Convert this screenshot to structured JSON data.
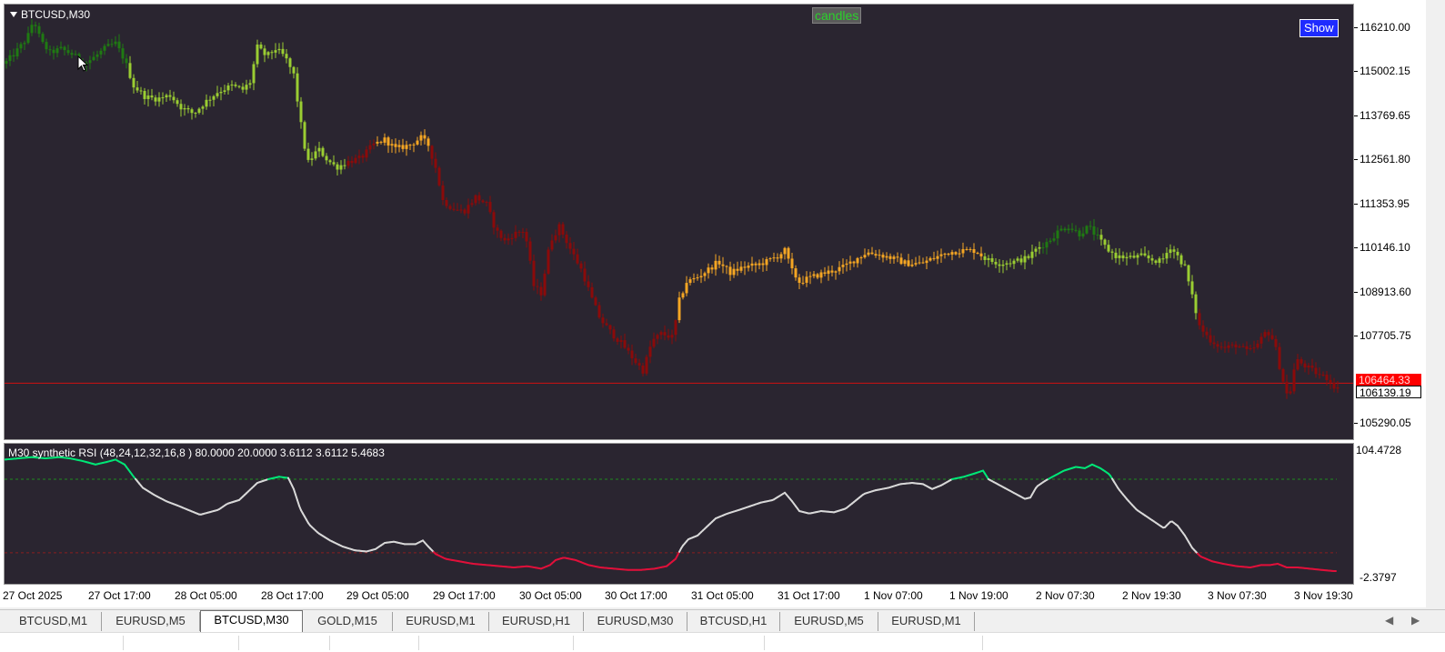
{
  "window": {
    "symbol_label": "BTCUSD,M30",
    "candles_button": "candles",
    "show_button": "Show"
  },
  "price_axis": {
    "ticks": [
      "116210.00",
      "115002.15",
      "113769.65",
      "112561.80",
      "111353.95",
      "110146.10",
      "108913.60",
      "107705.75",
      "105290.05"
    ],
    "bid_tag": "106464.33",
    "crosshair_tag": "106139.19"
  },
  "rsi": {
    "title": "M30 synthetic RSI  (48,24,12,32,16,8 ) 80.0000 20.0000 3.6112 3.6112 5.4683",
    "axis_top": "104.4728",
    "axis_bottom": "-2.3797",
    "upper_level": 80,
    "lower_level": 20
  },
  "time_axis": {
    "labels": [
      "27 Oct 2025",
      "27 Oct 17:00",
      "28 Oct 05:00",
      "28 Oct 17:00",
      "29 Oct 05:00",
      "29 Oct 17:00",
      "30 Oct 05:00",
      "30 Oct 17:00",
      "31 Oct 05:00",
      "31 Oct 17:00",
      "1 Nov 07:00",
      "1 Nov 19:00",
      "2 Nov 07:30",
      "2 Nov 19:30",
      "3 Nov 07:30",
      "3 Nov 19:30"
    ]
  },
  "tabs": [
    {
      "label": "BTCUSD,M1",
      "active": false
    },
    {
      "label": "EURUSD,M5",
      "active": false
    },
    {
      "label": "BTCUSD,M30",
      "active": true
    },
    {
      "label": "GOLD,M15",
      "active": false
    },
    {
      "label": "EURUSD,M1",
      "active": false
    },
    {
      "label": "EURUSD,H1",
      "active": false
    },
    {
      "label": "EURUSD,M30",
      "active": false
    },
    {
      "label": "BTCUSD,H1",
      "active": false
    },
    {
      "label": "EURUSD,M5",
      "active": false
    },
    {
      "label": "EURUSD,M1",
      "active": false
    }
  ],
  "colors": {
    "background": "#2a2530",
    "strong_up": "#1f7a12",
    "up": "#9acd32",
    "neutral": "#f5a623",
    "down": "#8b0a0a",
    "rsi_high": "#00e676",
    "rsi_mid": "#d8d8d8",
    "rsi_low": "#e0103a",
    "bid_line": "#d01010"
  },
  "chart_data": {
    "type": "candlestick",
    "ylim": [
      104900,
      116700
    ],
    "bid": 106464.33,
    "price_path": [
      [
        0,
        115100
      ],
      [
        12,
        115400
      ],
      [
        25,
        115800
      ],
      [
        32,
        116300
      ],
      [
        40,
        115700
      ],
      [
        50,
        115400
      ],
      [
        62,
        115500
      ],
      [
        75,
        115350
      ],
      [
        88,
        115100
      ],
      [
        100,
        115300
      ],
      [
        112,
        115550
      ],
      [
        122,
        115650
      ],
      [
        132,
        115200
      ],
      [
        142,
        114500
      ],
      [
        155,
        114200
      ],
      [
        168,
        114150
      ],
      [
        182,
        114250
      ],
      [
        195,
        113900
      ],
      [
        208,
        113750
      ],
      [
        220,
        114050
      ],
      [
        235,
        114350
      ],
      [
        250,
        114500
      ],
      [
        262,
        114400
      ],
      [
        270,
        114600
      ],
      [
        278,
        115550
      ],
      [
        288,
        115300
      ],
      [
        298,
        115500
      ],
      [
        308,
        115300
      ],
      [
        318,
        114800
      ],
      [
        325,
        113600
      ],
      [
        333,
        112400
      ],
      [
        345,
        112800
      ],
      [
        355,
        112500
      ],
      [
        365,
        112300
      ],
      [
        378,
        112450
      ],
      [
        392,
        112550
      ],
      [
        405,
        112900
      ],
      [
        418,
        113050
      ],
      [
        430,
        112800
      ],
      [
        445,
        112900
      ],
      [
        458,
        113100
      ],
      [
        466,
        112900
      ],
      [
        474,
        112300
      ],
      [
        482,
        111400
      ],
      [
        492,
        111200
      ],
      [
        505,
        111100
      ],
      [
        518,
        111500
      ],
      [
        530,
        111300
      ],
      [
        540,
        110600
      ],
      [
        550,
        110300
      ],
      [
        560,
        110500
      ],
      [
        572,
        110600
      ],
      [
        582,
        109100
      ],
      [
        590,
        108900
      ],
      [
        600,
        110300
      ],
      [
        610,
        110700
      ],
      [
        622,
        110100
      ],
      [
        635,
        109500
      ],
      [
        645,
        108800
      ],
      [
        655,
        108200
      ],
      [
        668,
        107800
      ],
      [
        680,
        107500
      ],
      [
        692,
        107100
      ],
      [
        702,
        106800
      ],
      [
        712,
        107600
      ],
      [
        722,
        107800
      ],
      [
        735,
        107700
      ],
      [
        742,
        108700
      ],
      [
        750,
        109200
      ],
      [
        760,
        109300
      ],
      [
        772,
        109500
      ],
      [
        785,
        109750
      ],
      [
        798,
        109450
      ],
      [
        812,
        109600
      ],
      [
        826,
        109650
      ],
      [
        838,
        109750
      ],
      [
        850,
        109900
      ],
      [
        858,
        110050
      ],
      [
        866,
        109500
      ],
      [
        874,
        109200
      ],
      [
        884,
        109300
      ],
      [
        896,
        109400
      ],
      [
        910,
        109500
      ],
      [
        922,
        109600
      ],
      [
        935,
        109800
      ],
      [
        948,
        110000
      ],
      [
        960,
        109950
      ],
      [
        975,
        109850
      ],
      [
        992,
        109700
      ],
      [
        1008,
        109700
      ],
      [
        1022,
        109850
      ],
      [
        1038,
        110000
      ],
      [
        1052,
        110050
      ],
      [
        1068,
        110050
      ],
      [
        1080,
        109800
      ],
      [
        1095,
        109700
      ],
      [
        1110,
        109750
      ],
      [
        1125,
        109850
      ],
      [
        1135,
        110100
      ],
      [
        1148,
        110300
      ],
      [
        1160,
        110600
      ],
      [
        1170,
        110700
      ],
      [
        1182,
        110500
      ],
      [
        1192,
        110700
      ],
      [
        1202,
        110400
      ],
      [
        1212,
        110100
      ],
      [
        1222,
        109900
      ],
      [
        1235,
        109850
      ],
      [
        1250,
        109900
      ],
      [
        1262,
        109800
      ],
      [
        1272,
        109750
      ],
      [
        1282,
        110150
      ],
      [
        1290,
        109900
      ],
      [
        1298,
        109600
      ],
      [
        1306,
        108800
      ],
      [
        1314,
        108000
      ],
      [
        1325,
        107650
      ],
      [
        1340,
        107400
      ],
      [
        1355,
        107500
      ],
      [
        1368,
        107300
      ],
      [
        1378,
        107500
      ],
      [
        1388,
        107900
      ],
      [
        1396,
        107600
      ],
      [
        1404,
        106700
      ],
      [
        1412,
        106000
      ],
      [
        1420,
        107100
      ],
      [
        1432,
        106900
      ],
      [
        1445,
        106700
      ],
      [
        1455,
        106600
      ],
      [
        1465,
        106300
      ]
    ],
    "color_segments": [
      {
        "from": 0,
        "to": 135,
        "trend": "strong_up"
      },
      {
        "from": 135,
        "to": 378,
        "trend": "up"
      },
      {
        "from": 378,
        "to": 410,
        "trend": "down"
      },
      {
        "from": 410,
        "to": 470,
        "trend": "neutral"
      },
      {
        "from": 470,
        "to": 742,
        "trend": "down"
      },
      {
        "from": 742,
        "to": 1075,
        "trend": "neutral"
      },
      {
        "from": 1075,
        "to": 1140,
        "trend": "up"
      },
      {
        "from": 1140,
        "to": 1205,
        "trend": "strong_up"
      },
      {
        "from": 1205,
        "to": 1312,
        "trend": "up"
      },
      {
        "from": 1312,
        "to": 1470,
        "trend": "down"
      }
    ],
    "rsi_path": [
      [
        0,
        96
      ],
      [
        15,
        97
      ],
      [
        30,
        98
      ],
      [
        45,
        97
      ],
      [
        60,
        98
      ],
      [
        72,
        97
      ],
      [
        85,
        95
      ],
      [
        100,
        92
      ],
      [
        112,
        94
      ],
      [
        122,
        96
      ],
      [
        132,
        92
      ],
      [
        142,
        82
      ],
      [
        152,
        73
      ],
      [
        165,
        67
      ],
      [
        178,
        62
      ],
      [
        192,
        58
      ],
      [
        205,
        54
      ],
      [
        215,
        51
      ],
      [
        225,
        53
      ],
      [
        235,
        55
      ],
      [
        245,
        60
      ],
      [
        258,
        63
      ],
      [
        268,
        70
      ],
      [
        278,
        77
      ],
      [
        290,
        80
      ],
      [
        302,
        82
      ],
      [
        312,
        81
      ],
      [
        318,
        72
      ],
      [
        325,
        56
      ],
      [
        335,
        43
      ],
      [
        345,
        36
      ],
      [
        358,
        30
      ],
      [
        372,
        25
      ],
      [
        385,
        22
      ],
      [
        398,
        21
      ],
      [
        408,
        23
      ],
      [
        418,
        28
      ],
      [
        428,
        29
      ],
      [
        440,
        27
      ],
      [
        452,
        27
      ],
      [
        460,
        30
      ],
      [
        466,
        25
      ],
      [
        474,
        19
      ],
      [
        485,
        15
      ],
      [
        500,
        13
      ],
      [
        515,
        11
      ],
      [
        530,
        10
      ],
      [
        545,
        9
      ],
      [
        560,
        8
      ],
      [
        575,
        9
      ],
      [
        590,
        7
      ],
      [
        600,
        10
      ],
      [
        606,
        14
      ],
      [
        615,
        16
      ],
      [
        628,
        14
      ],
      [
        642,
        10
      ],
      [
        655,
        8
      ],
      [
        670,
        7
      ],
      [
        685,
        6
      ],
      [
        700,
        6
      ],
      [
        715,
        7
      ],
      [
        728,
        9
      ],
      [
        738,
        15
      ],
      [
        745,
        25
      ],
      [
        752,
        31
      ],
      [
        762,
        34
      ],
      [
        772,
        41
      ],
      [
        782,
        48
      ],
      [
        795,
        52
      ],
      [
        808,
        55
      ],
      [
        820,
        58
      ],
      [
        832,
        61
      ],
      [
        845,
        63
      ],
      [
        858,
        69
      ],
      [
        866,
        62
      ],
      [
        874,
        54
      ],
      [
        885,
        52
      ],
      [
        898,
        54
      ],
      [
        912,
        53
      ],
      [
        925,
        56
      ],
      [
        935,
        62
      ],
      [
        945,
        68
      ],
      [
        958,
        71
      ],
      [
        972,
        73
      ],
      [
        985,
        76
      ],
      [
        998,
        77
      ],
      [
        1010,
        76
      ],
      [
        1020,
        72
      ],
      [
        1030,
        75
      ],
      [
        1042,
        80
      ],
      [
        1055,
        82
      ],
      [
        1068,
        85
      ],
      [
        1076,
        87
      ],
      [
        1082,
        80
      ],
      [
        1092,
        76
      ],
      [
        1102,
        72
      ],
      [
        1112,
        68
      ],
      [
        1122,
        64
      ],
      [
        1128,
        65
      ],
      [
        1135,
        74
      ],
      [
        1145,
        79
      ],
      [
        1155,
        83
      ],
      [
        1165,
        87
      ],
      [
        1178,
        90
      ],
      [
        1188,
        89
      ],
      [
        1196,
        92
      ],
      [
        1205,
        89
      ],
      [
        1215,
        84
      ],
      [
        1225,
        72
      ],
      [
        1235,
        63
      ],
      [
        1245,
        55
      ],
      [
        1255,
        50
      ],
      [
        1265,
        45
      ],
      [
        1275,
        40
      ],
      [
        1283,
        46
      ],
      [
        1290,
        42
      ],
      [
        1298,
        34
      ],
      [
        1306,
        24
      ],
      [
        1315,
        17
      ],
      [
        1328,
        13
      ],
      [
        1340,
        11
      ],
      [
        1355,
        9
      ],
      [
        1370,
        8
      ],
      [
        1382,
        10
      ],
      [
        1392,
        10
      ],
      [
        1400,
        11
      ],
      [
        1410,
        8
      ],
      [
        1422,
        8
      ],
      [
        1435,
        7
      ],
      [
        1448,
        6
      ],
      [
        1462,
        5
      ]
    ]
  }
}
